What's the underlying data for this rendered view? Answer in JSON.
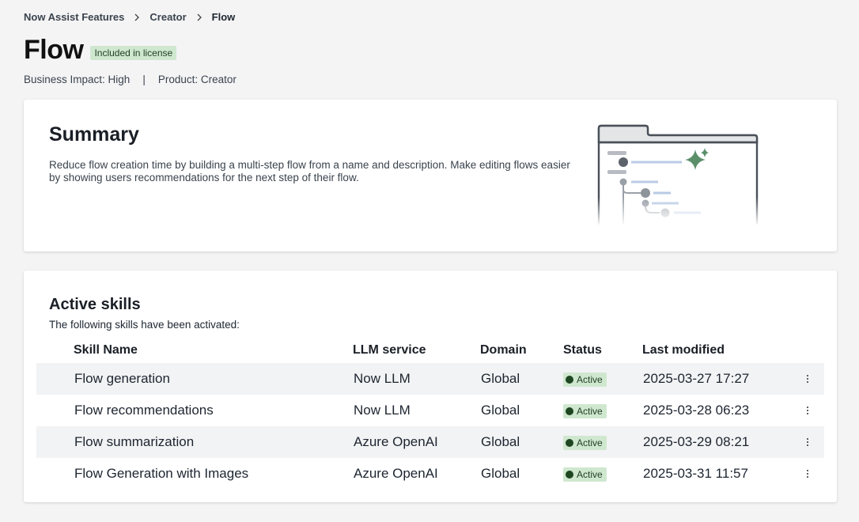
{
  "breadcrumb": {
    "items": [
      "Now Assist Features",
      "Creator",
      "Flow"
    ]
  },
  "header": {
    "title": "Flow",
    "badge": "Included in license",
    "business_impact": "Business Impact: High",
    "divider": "|",
    "product": "Product: Creator"
  },
  "summary": {
    "title": "Summary",
    "description": "Reduce flow creation time by building a multi-step flow from a name and description. Make editing flows easier by showing users recommendations for the next step of their flow."
  },
  "skills": {
    "title": "Active skills",
    "subtitle": "The following skills have been activated:",
    "columns": [
      "Skill Name",
      "LLM service",
      "Domain",
      "Status",
      "Last modified"
    ],
    "rows": [
      {
        "name": "Flow generation",
        "llm": "Now LLM",
        "domain": "Global",
        "status": "Active",
        "modified": "2025-03-27 17:27"
      },
      {
        "name": "Flow recommendations",
        "llm": "Now LLM",
        "domain": "Global",
        "status": "Active",
        "modified": "2025-03-28 06:23"
      },
      {
        "name": "Flow summarization",
        "llm": "Azure OpenAI",
        "domain": "Global",
        "status": "Active",
        "modified": "2025-03-29 08:21"
      },
      {
        "name": "Flow Generation with Images",
        "llm": "Azure OpenAI",
        "domain": "Global",
        "status": "Active",
        "modified": "2025-03-31 11:57"
      }
    ]
  },
  "colors": {
    "badge_bg": "#cfe7cf",
    "status_dot": "#1e4620",
    "sparkle": "#5a8f6a",
    "page_bg": "#f4f4f5"
  }
}
